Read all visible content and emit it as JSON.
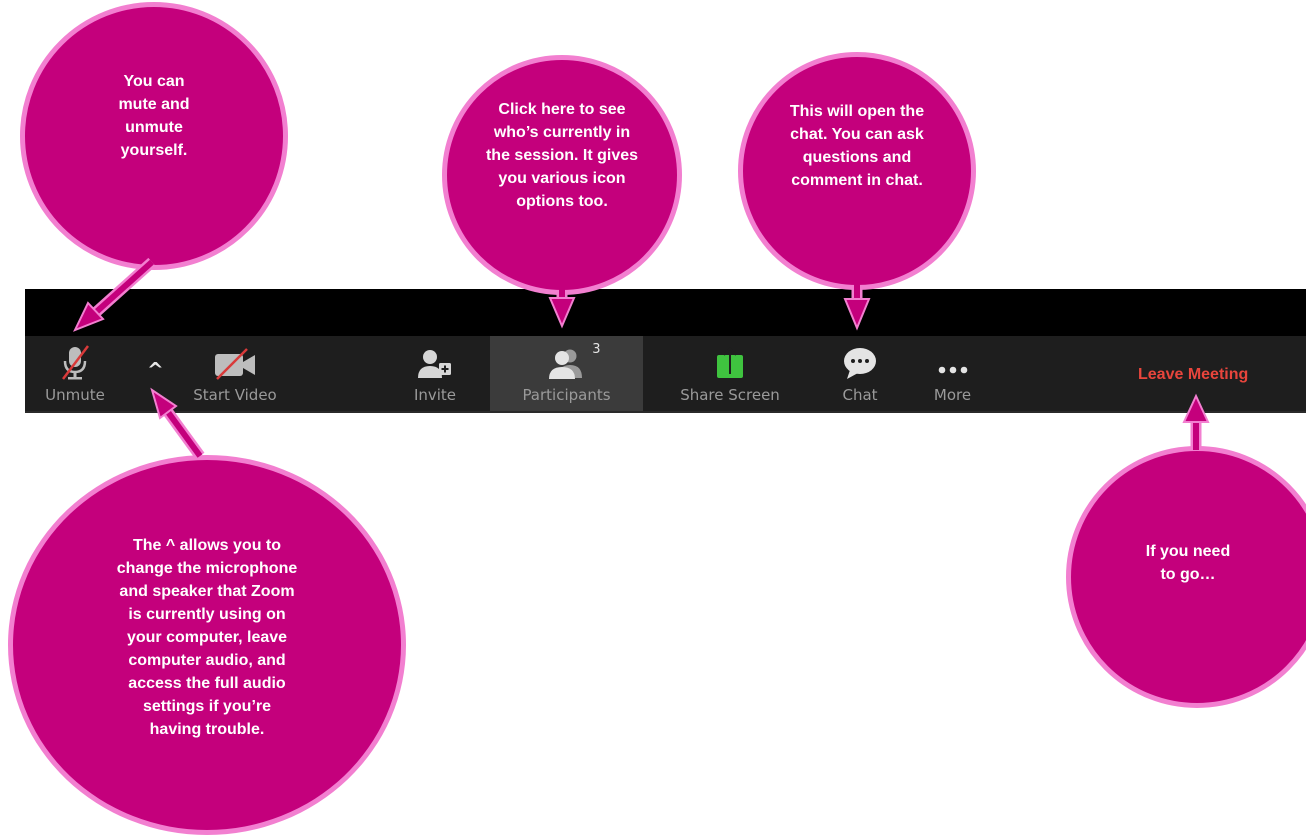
{
  "callouts": {
    "mute": "You can\nmute and\nunmute\nyourself.",
    "participants": "Click here to see\nwho’s currently in\nthe session. It gives\nyou various icon\noptions too.",
    "chat": "This will open the\nchat. You can ask\nquestions and\ncomment in chat.",
    "audio": "The ^ allows you to\nchange the microphone\nand speaker that Zoom\nis currently using on\nyour computer, leave\ncomputer audio, and\naccess the full audio\nsettings if you’re\nhaving trouble.",
    "leave": "If you need\nto go…"
  },
  "toolbar": {
    "unmute": "Unmute",
    "caret": "^",
    "start_video": "Start Video",
    "invite": "Invite",
    "participants": "Participants",
    "participant_count": "3",
    "share_screen": "Share Screen",
    "chat": "Chat",
    "more": "More",
    "leave_meeting": "Leave Meeting"
  },
  "colors": {
    "bubble_fill": "#c4007c",
    "bubble_border": "#f27fd0",
    "toolbar_bg": "#1e1e1e",
    "leave_red": "#e8453c",
    "share_green": "#3fc33f"
  },
  "icons": [
    "mic-muted-icon",
    "chevron-up-icon",
    "video-off-icon",
    "invite-icon",
    "participants-icon",
    "share-screen-icon",
    "chat-icon",
    "more-icon"
  ]
}
